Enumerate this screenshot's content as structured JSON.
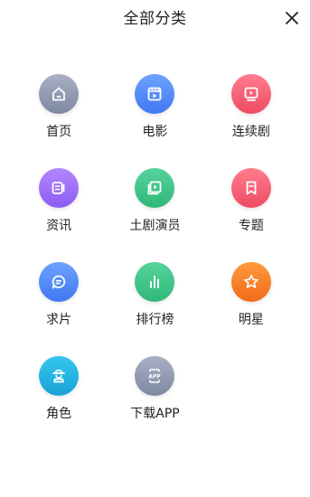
{
  "header": {
    "title": "全部分类",
    "close_icon": "close-icon"
  },
  "categories": [
    {
      "label": "首页",
      "icon": "home-icon",
      "color_from": "#a9b0c4",
      "color_to": "#7f88a3"
    },
    {
      "label": "电影",
      "icon": "film-icon",
      "color_from": "#6ea2ff",
      "color_to": "#3f78f2"
    },
    {
      "label": "连续剧",
      "icon": "tv-icon",
      "color_from": "#ff7d8e",
      "color_to": "#ef4b62"
    },
    {
      "label": "资讯",
      "icon": "news-video-icon",
      "color_from": "#b388ff",
      "color_to": "#8a5cf0"
    },
    {
      "label": "土剧演员",
      "icon": "playlist-icon",
      "color_from": "#56d39b",
      "color_to": "#2fb878"
    },
    {
      "label": "专题",
      "icon": "bookmark-icon",
      "color_from": "#ff7d8e",
      "color_to": "#ef4b62"
    },
    {
      "label": "求片",
      "icon": "chat-icon",
      "color_from": "#6ea2ff",
      "color_to": "#3f78f2"
    },
    {
      "label": "排行榜",
      "icon": "bar-chart-icon",
      "color_from": "#56d39b",
      "color_to": "#2fb878"
    },
    {
      "label": "明星",
      "icon": "star-icon",
      "color_from": "#ff9a3c",
      "color_to": "#f26a1b"
    },
    {
      "label": "角色",
      "icon": "character-icon",
      "color_from": "#35c6ee",
      "color_to": "#1aa3d6"
    },
    {
      "label": "下载APP",
      "icon": "app-icon",
      "color_from": "#a9b0c4",
      "color_to": "#7f88a3"
    }
  ]
}
